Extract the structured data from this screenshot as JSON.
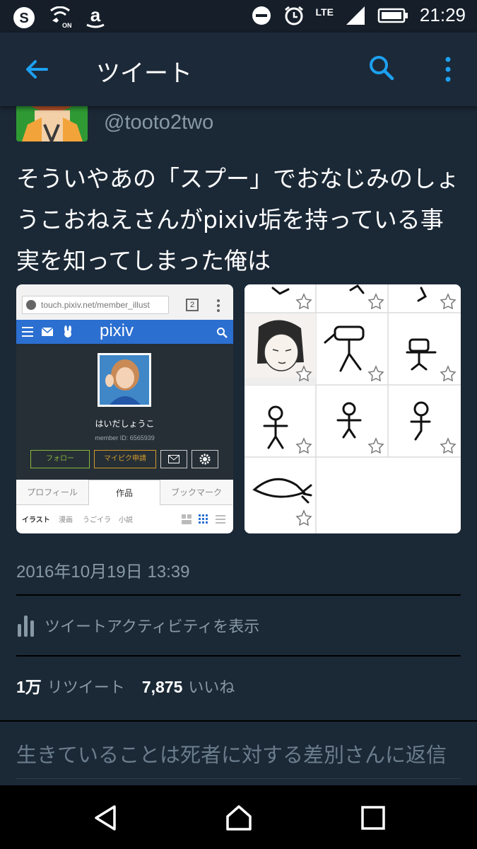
{
  "status_bar": {
    "time": "21:29",
    "network": "LTE",
    "icons": [
      "skype-icon",
      "wifi-calling-icon",
      "amazon-icon",
      "do-not-disturb-icon",
      "alarm-icon",
      "signal-icon",
      "battery-icon"
    ]
  },
  "app_bar": {
    "title": "ツイート",
    "back_icon": "arrow-left-icon",
    "search_icon": "search-icon",
    "more_icon": "more-vertical-icon"
  },
  "tweet": {
    "handle": "@tooto2two",
    "text": "そういやあの「スプー」でおなじみのしょうこおねえさんがpixiv垢を持っている事実を知ってしまった俺は",
    "timestamp": "2016年10月19日 13:39"
  },
  "media_left": {
    "url": "touch.pixiv.net/member_illust",
    "tab_count": "2",
    "logo": "pixiv",
    "profile_name": "はいだしょうこ",
    "member_id": "member ID: 6565939",
    "buttons": [
      "フォロー",
      "マイピク申請"
    ],
    "tabs": [
      "プロフィール",
      "作品",
      "ブックマーク"
    ],
    "subtabs": [
      "イラスト",
      "漫画",
      "うごイラ",
      "小説"
    ]
  },
  "activity": {
    "label": "ツイートアクティビティを表示",
    "icon": "bar-chart-icon"
  },
  "stats": {
    "retweets": "1万",
    "retweets_label": "リツイート",
    "likes": "7,875",
    "likes_label": "いいね"
  },
  "reply": {
    "placeholder": "生きていることは死者に対する差別さんに返信"
  },
  "nav_bar": {
    "back_icon": "nav-back-icon",
    "home_icon": "nav-home-icon",
    "recents_icon": "nav-recents-icon"
  },
  "colors": {
    "background": "#1b2836",
    "accent": "#1da1f2",
    "secondary_text": "#8899a6"
  }
}
